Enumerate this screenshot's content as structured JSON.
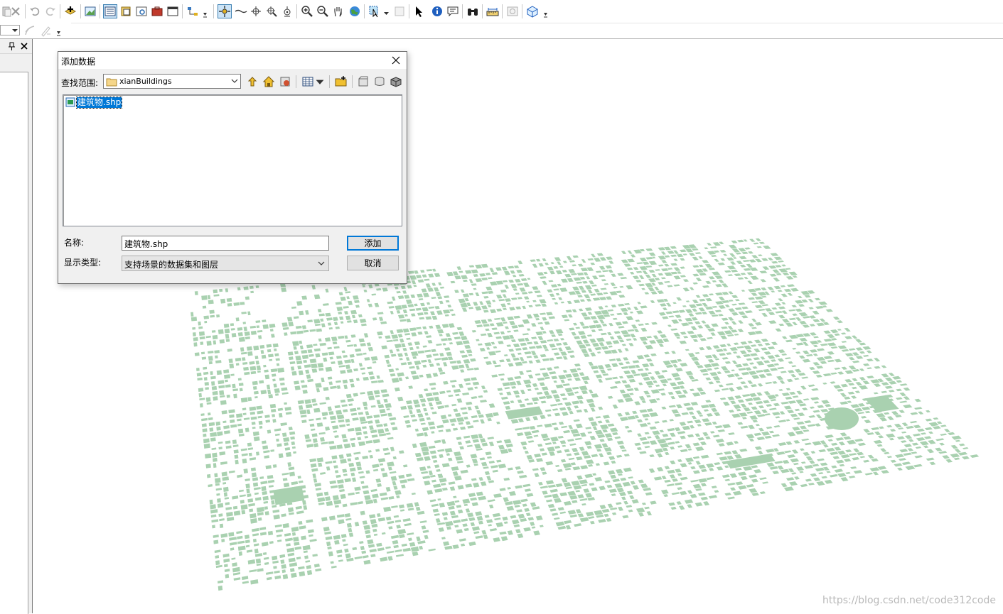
{
  "toolbar": {
    "row1_icons": [
      "paste-icon",
      "delete-icon",
      "undo-icon",
      "redo-icon",
      "add-data-icon",
      "scene-properties-icon",
      "table-of-contents-icon",
      "catalog-icon",
      "search-window-icon",
      "arctoolbox-icon",
      "python-window-icon",
      "model-builder-icon",
      "navigate-icon",
      "fly-icon",
      "target-center-icon",
      "zoom-to-target-icon",
      "set-observer-icon",
      "zoom-in-icon",
      "zoom-out-icon",
      "pan-icon",
      "full-extent-icon",
      "select-features-icon",
      "clear-selection-icon",
      "select-elements-icon",
      "identify-icon",
      "html-popup-icon",
      "find-icon",
      "measure-icon",
      "time-slider-icon",
      "3d-effects-icon"
    ],
    "row2_icons": [
      "layer-dropdown",
      "snapping-icon",
      "editor-icon"
    ]
  },
  "dialog": {
    "title": "添加数据",
    "lookin_label": "查找范围:",
    "lookin_value": "xianBuildings",
    "files": [
      {
        "name": "建筑物.shp",
        "selected": true
      }
    ],
    "name_label": "名称:",
    "name_value": "建筑物.shp",
    "type_label": "显示类型:",
    "type_value": "支持场景的数据集和图层",
    "add_label": "添加",
    "cancel_label": "取消"
  },
  "scene": {
    "building_color": "#a9d1b0",
    "watermark": "https://blog.csdn.net/code312code"
  },
  "colors": {
    "accent": "#0078d7",
    "toolbar_pressed": "#cce4f7"
  }
}
